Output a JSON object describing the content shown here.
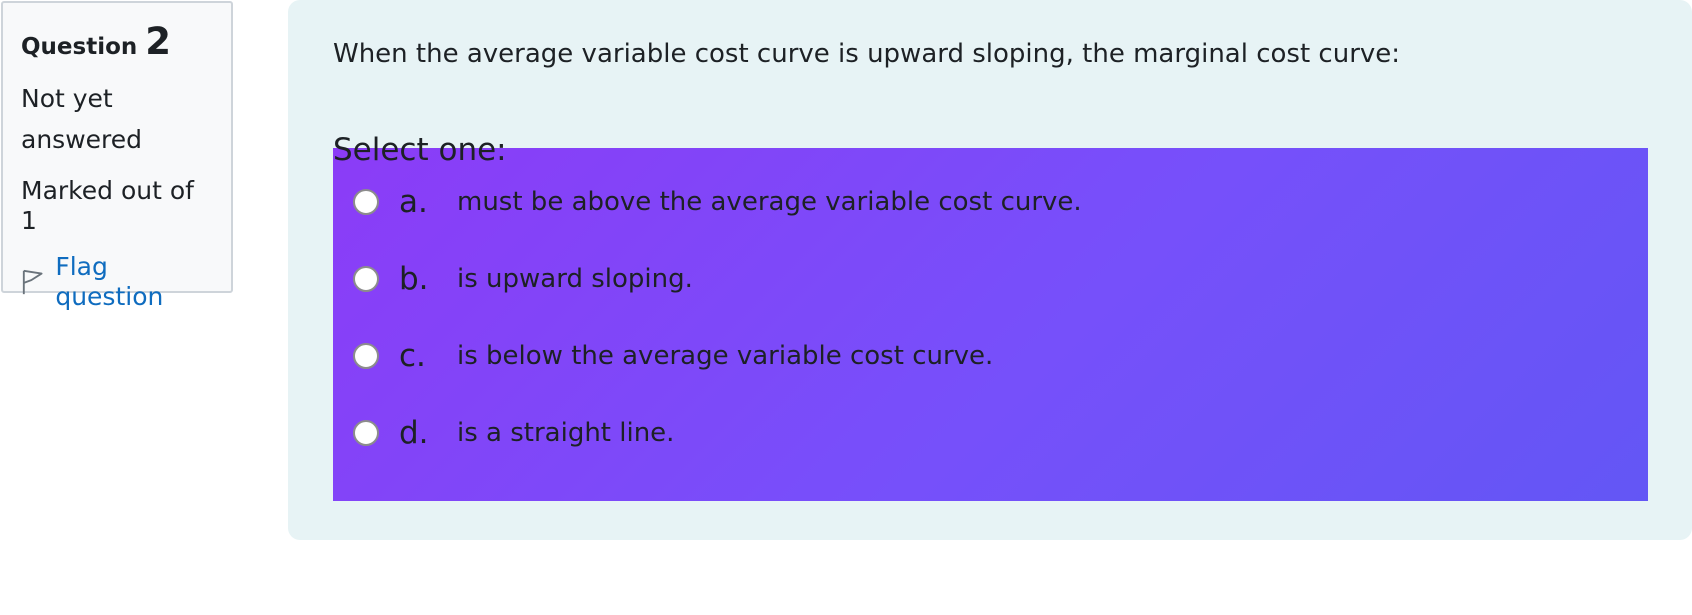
{
  "info": {
    "question_label": "Question",
    "question_number": "2",
    "state": "Not yet answered",
    "grade": "Marked out of 1",
    "flag_label": "Flag question"
  },
  "question": {
    "text": "When the average variable cost curve is upward sloping, the marginal cost curve:",
    "prompt": "Select one:",
    "options": [
      {
        "letter": "a.",
        "text": "must be above the average variable cost curve.",
        "selected": false
      },
      {
        "letter": "b.",
        "text": "is upward sloping.",
        "selected": false
      },
      {
        "letter": "c.",
        "text": "is below the average variable cost curve.",
        "selected": false
      },
      {
        "letter": "d.",
        "text": "is a straight line.",
        "selected": false
      }
    ]
  },
  "colors": {
    "link": "#0f6cbf",
    "panel_bg": "#e7f3f5",
    "answer_gradient_start": "#8b3cf7",
    "answer_gradient_end": "#6356f5"
  }
}
